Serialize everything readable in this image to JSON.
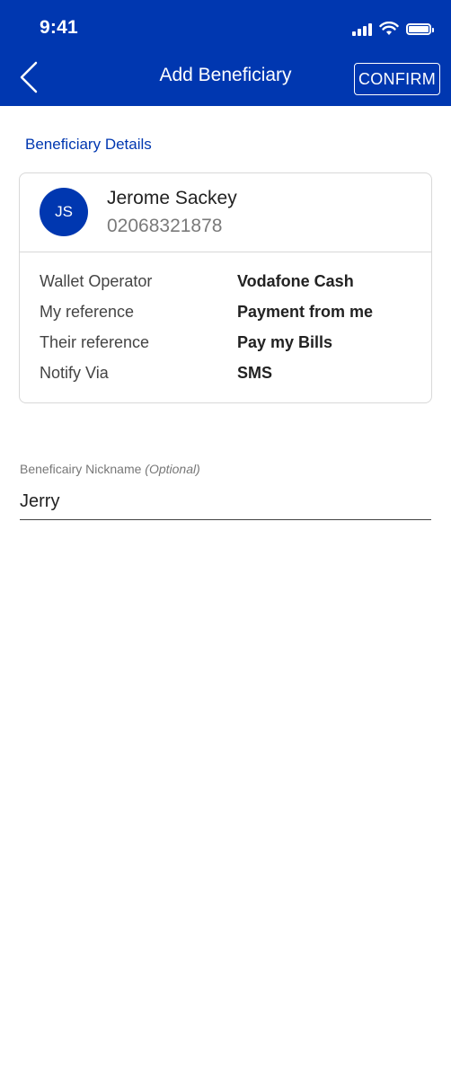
{
  "status_bar": {
    "time": "9:41"
  },
  "header": {
    "title": "Add Beneficiary",
    "confirm_label": "CONFIRM",
    "background_color": "#0037b0"
  },
  "section": {
    "heading": "Beneficiary Details"
  },
  "beneficiary": {
    "initials": "JS",
    "name": "Jerome Sackey",
    "phone": "02068321878",
    "details": [
      {
        "label": "Wallet Operator",
        "value": "Vodafone Cash"
      },
      {
        "label": "My reference",
        "value": "Payment from me"
      },
      {
        "label": "Their reference",
        "value": "Pay my Bills"
      },
      {
        "label": "Notify Via",
        "value": "SMS"
      }
    ]
  },
  "nickname": {
    "label": "Beneficairy Nickname",
    "optional_label": "(Optional)",
    "value": "Jerry"
  },
  "icons": {
    "back": "chevron-left-icon",
    "signal": "cellular-signal-icon",
    "wifi": "wifi-icon",
    "battery": "battery-icon"
  }
}
